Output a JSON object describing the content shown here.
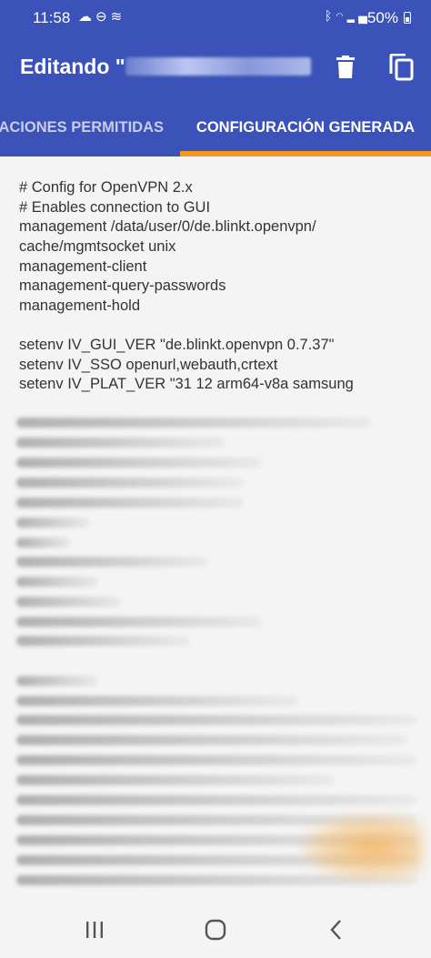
{
  "status_bar": {
    "time": "11:58",
    "battery": "50%",
    "left_icons": [
      "cloud-sync-icon",
      "do-not-disturb-icon",
      "wavy-icon"
    ],
    "right_icons": [
      "bluetooth-icon",
      "wifi-icon",
      "signal-icon",
      "battery-icon"
    ]
  },
  "app_bar": {
    "title": "Editando \"",
    "actions": [
      "delete-icon",
      "copy-icon"
    ],
    "color": "#3b52b8"
  },
  "tabs": {
    "items": [
      {
        "label": "ACIONES PERMITIDAS",
        "active": false
      },
      {
        "label": "CONFIGURACIÓN GENERADA",
        "active": true
      }
    ],
    "indicator_color": "#f39a1e"
  },
  "config_text": {
    "lines": [
      "# Config for OpenVPN 2.x",
      "# Enables connection to GUI",
      "management /data/user/0/de.blinkt.openvpn/",
      "cache/mgmtsocket unix",
      "management-client",
      "management-query-passwords",
      "management-hold",
      "",
      "setenv IV_GUI_VER \"de.blinkt.openvpn 0.7.37\"",
      "setenv IV_SSO openurl,webauth,crtext",
      "setenv IV_PLAT_VER \"31 12 arm64-v8a samsung"
    ]
  },
  "nav_bar": {
    "buttons": [
      "recents-icon",
      "home-icon",
      "back-icon"
    ]
  }
}
